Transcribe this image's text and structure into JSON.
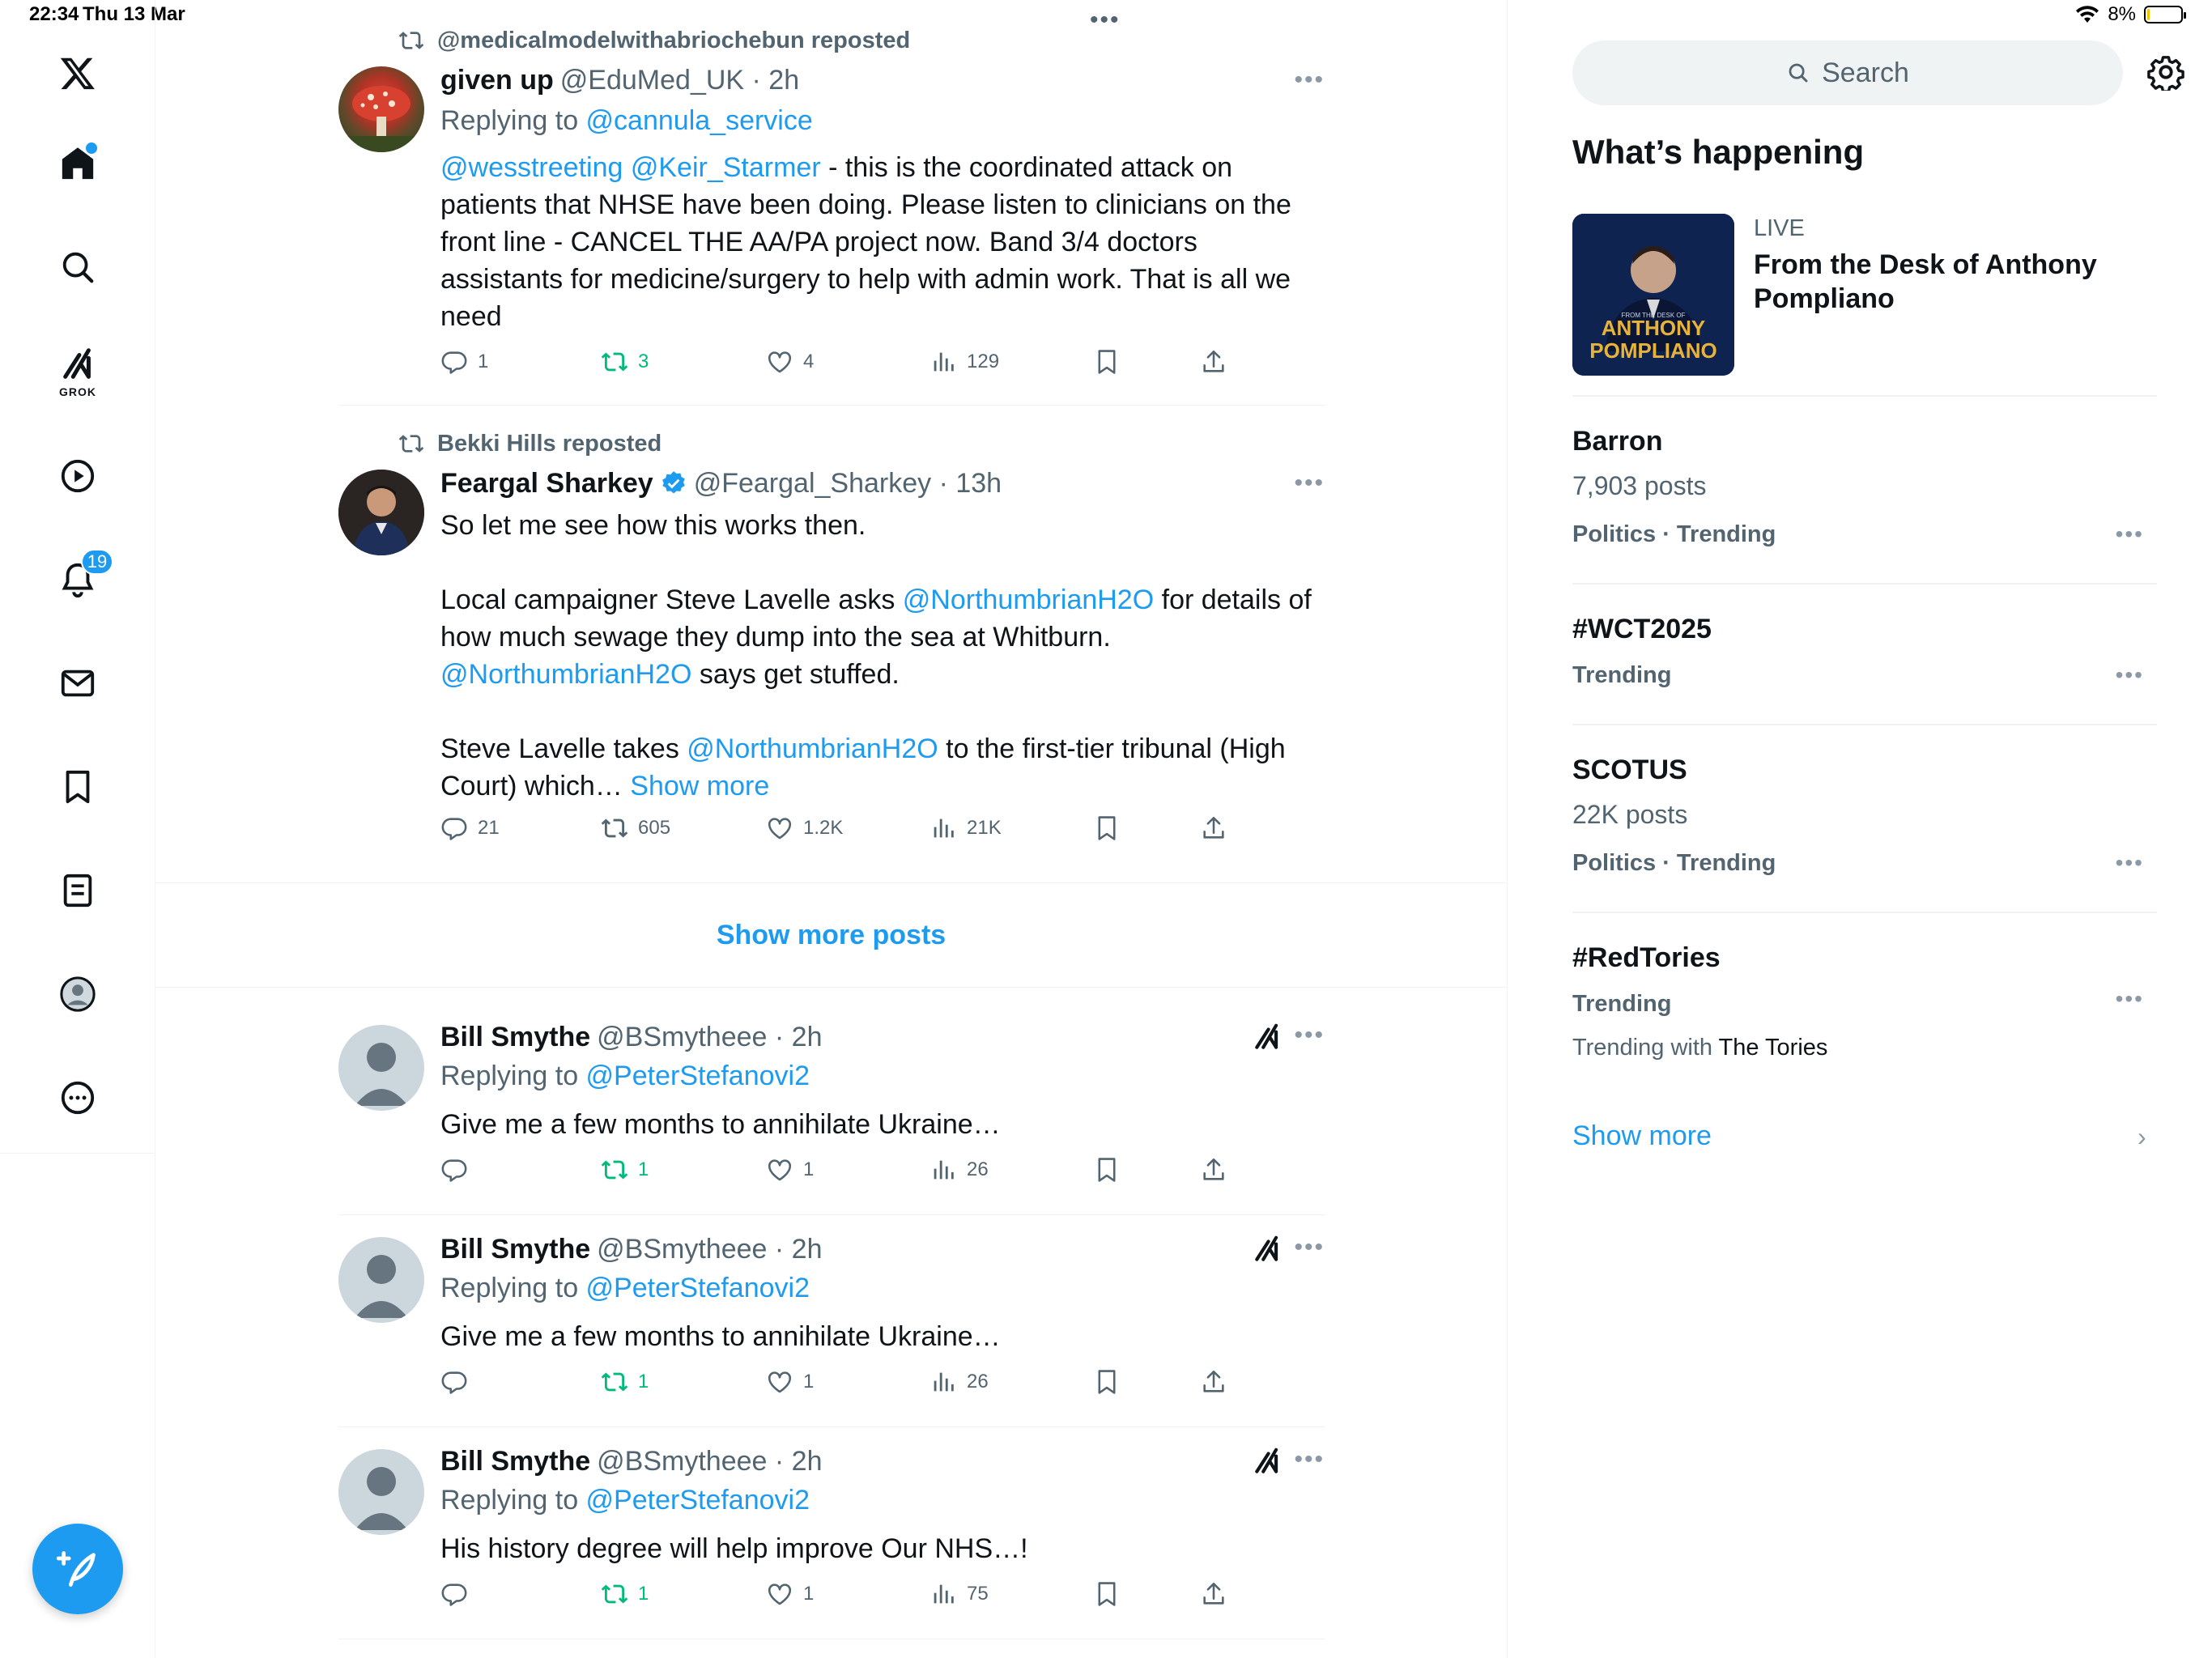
{
  "status": {
    "time": "22:34",
    "date": "Thu 13 Mar",
    "battery": "8%",
    "battery_level": 0.08
  },
  "nav": {
    "grok_label": "GROK",
    "notifications_count": "19",
    "items": [
      "x-logo",
      "home",
      "search",
      "grok",
      "video",
      "notifications",
      "messages",
      "bookmarks",
      "lists",
      "profile",
      "more"
    ]
  },
  "tweets": [
    {
      "repost_by": "@medicalmodelwithabriochebun reposted",
      "name": "given up",
      "handle": "@EduMed_UK · 2h",
      "replying_prefix": "Replying to ",
      "replying_to": "@cannula_service",
      "mention_1": "@wesstreeting",
      "mention_2": "@Keir_Starmer",
      "text": " - this is the coordinated attack on patients that NHSE have been doing. Please listen to clinicians on the front line - CANCEL THE AA/PA project now. Band 3/4 doctors assistants for medicine/surgery to help with admin work. That is all we need",
      "replies": "1",
      "reposts": "3",
      "likes": "4",
      "views": "129"
    },
    {
      "repost_by": "Bekki Hills reposted",
      "name": "Feargal Sharkey",
      "handle": "@Feargal_Sharkey · 13h",
      "line1": "So let me see how this works then.",
      "p2_a": "Local campaigner Steve Lavelle asks ",
      "p2_link": "@NorthumbrianH2O",
      "p2_b": " for details of how much sewage they dump into the sea at Whitburn.",
      "p2_link2": "@NorthumbrianH2O",
      "p2_c": " says get stuffed.",
      "p3_a": "Steve Lavelle takes ",
      "p3_link": "@NorthumbrianH2O",
      "p3_b": " to the first-tier tribunal (High Court) which… ",
      "show_more": "Show more",
      "replies": "21",
      "reposts": "605",
      "likes": "1.2K",
      "views": "21K"
    }
  ],
  "show_more_posts": "Show more posts",
  "replies": [
    {
      "name": "Bill Smythe",
      "handle": "@BSmytheee · 2h",
      "replying_prefix": "Replying to ",
      "replying_to": "@PeterStefanovi2",
      "text": "Give me a few months to annihilate Ukraine…",
      "reposts": "1",
      "likes": "1",
      "views": "26"
    },
    {
      "name": "Bill Smythe",
      "handle": "@BSmytheee · 2h",
      "replying_prefix": "Replying to ",
      "replying_to": "@PeterStefanovi2",
      "text": "Give me a few months to annihilate Ukraine…",
      "reposts": "1",
      "likes": "1",
      "views": "26"
    },
    {
      "name": "Bill Smythe",
      "handle": "@BSmytheee · 2h",
      "replying_prefix": "Replying to ",
      "replying_to": "@PeterStefanovi2",
      "text": "His history degree will help improve Our NHS…!",
      "reposts": "1",
      "likes": "1",
      "views": "75"
    }
  ],
  "right": {
    "search_placeholder": "Search",
    "section_title": "What’s happening",
    "live": {
      "label": "LIVE",
      "title": "From the Desk of Anthony Pompliano",
      "thumb_small": "FROM THE DESK OF",
      "thumb_big1": "ANTHONY",
      "thumb_big2": "POMPLIANO"
    },
    "trends": [
      {
        "name": "Barron",
        "posts": "7,903 posts",
        "category": "Politics · Trending"
      },
      {
        "name": "#WCT2025",
        "category": "Trending"
      },
      {
        "name": "SCOTUS",
        "posts": "22K posts",
        "category": "Politics · Trending"
      },
      {
        "name": "#RedTories",
        "category": "Trending",
        "with_prefix": "Trending with ",
        "with_topic": "The Tories"
      }
    ],
    "show_more": "Show more"
  },
  "colors": {
    "accent": "#1d9bf0",
    "repost_green": "#00ba7c",
    "muted": "#536471",
    "text": "#0f1419"
  }
}
